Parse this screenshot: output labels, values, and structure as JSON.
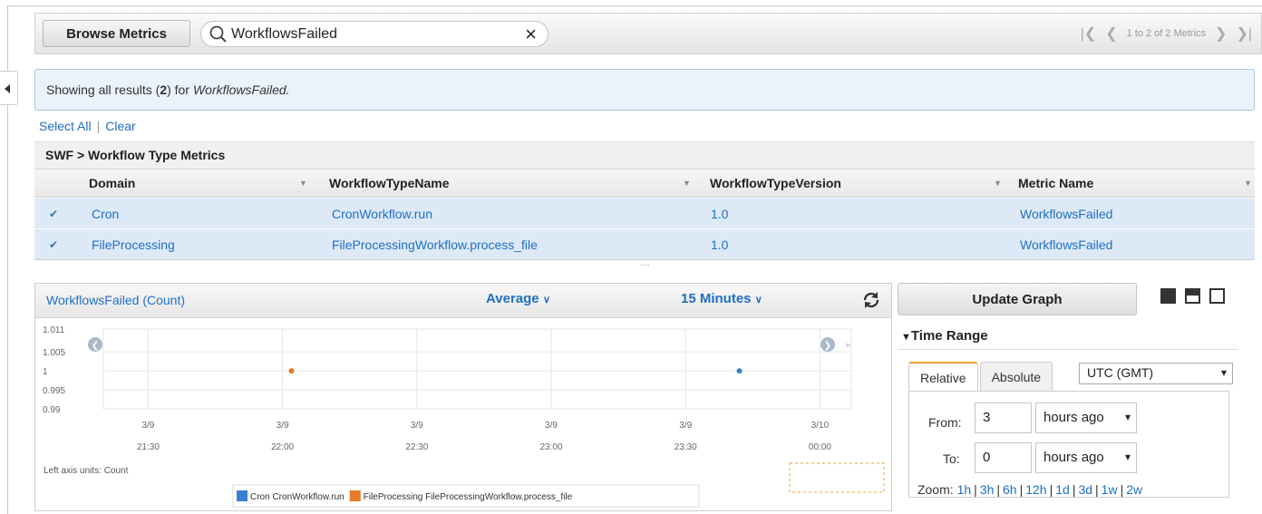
{
  "topbar": {
    "browse_label": "Browse Metrics",
    "search_value": "WorkflowsFailed",
    "clear_icon": "×",
    "pager_text": "1 to 2 of 2 Metrics"
  },
  "banner": {
    "prefix": "Showing all results (",
    "count": "2",
    "mid": ") for",
    "query": "WorkflowsFailed."
  },
  "selection": {
    "select_all": "Select All",
    "separator": "|",
    "clear": "Clear"
  },
  "group_title": "SWF > Workflow Type Metrics",
  "columns": [
    "Domain",
    "WorkflowTypeName",
    "WorkflowTypeVersion",
    "Metric Name"
  ],
  "rows": [
    {
      "domain": "Cron",
      "type_name": "CronWorkflow.run",
      "version": "1.0",
      "metric": "WorkflowsFailed",
      "checked": true
    },
    {
      "domain": "FileProcessing",
      "type_name": "FileProcessingWorkflow.process_file",
      "version": "1.0",
      "metric": "WorkflowsFailed",
      "checked": true
    }
  ],
  "splitter_dots": "....",
  "chart_panel": {
    "title": "WorkflowsFailed (Count)",
    "statistic": "Average",
    "period": "15 Minutes",
    "units_label": "Left axis units: Count"
  },
  "chart_data": {
    "type": "scatter",
    "yticks": [
      "1.011",
      "1.005",
      "1",
      "0.995",
      "0.99"
    ],
    "ylim": [
      0.99,
      1.011
    ],
    "xticks": [
      {
        "d": "3/9",
        "t": "21:30"
      },
      {
        "d": "3/9",
        "t": "22:00"
      },
      {
        "d": "3/9",
        "t": "22:30"
      },
      {
        "d": "3/9",
        "t": "23:00"
      },
      {
        "d": "3/9",
        "t": "23:30"
      },
      {
        "d": "3/10",
        "t": "00:00"
      }
    ],
    "x_minutes": [
      0,
      30,
      60,
      90,
      120,
      150
    ],
    "series": [
      {
        "name": "Cron CronWorkflow.run",
        "color": "#3b7fd0",
        "points": [
          {
            "x": 132,
            "y": 1
          }
        ]
      },
      {
        "name": "FileProcessing FileProcessingWorkflow.process_file",
        "color": "#e57b28",
        "points": [
          {
            "x": 32,
            "y": 1
          }
        ]
      }
    ]
  },
  "right_panel": {
    "update_label": "Update Graph",
    "time_range_label": "Time Range",
    "tab_relative": "Relative",
    "tab_absolute": "Absolute",
    "timezone": "UTC (GMT)",
    "from_label": "From:",
    "from_value": "3",
    "from_unit": "hours ago",
    "to_label": "To:",
    "to_value": "0",
    "to_unit": "hours ago",
    "zoom_label": "Zoom:",
    "zoom_options": [
      "1h",
      "3h",
      "6h",
      "12h",
      "1d",
      "3d",
      "1w",
      "2w"
    ]
  }
}
